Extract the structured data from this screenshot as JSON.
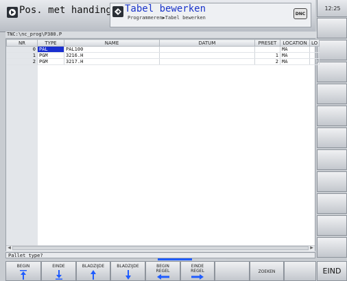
{
  "header": {
    "mode1_label": "Pos. met handingave",
    "mode2_label": "Tabel bewerken",
    "breadcrumb": "Programmeren▶Tabel bewerken",
    "dnc_label": "DNC",
    "clock": "12:25"
  },
  "file_path": "TNC:\\nc_prog\\P380.P",
  "table": {
    "columns": [
      "NR",
      "TYPE",
      "NAME",
      "DATUM",
      "PRESET",
      "LOCATION",
      "LO"
    ],
    "rows": [
      {
        "nr": "0",
        "type": "PAL",
        "name": "PAL100",
        "datum": "",
        "preset": "",
        "location": "MA"
      },
      {
        "nr": "1",
        "type": "PGM",
        "name": "3216.H",
        "datum": "",
        "preset": "1",
        "location": "MA"
      },
      {
        "nr": "2",
        "type": "PGM",
        "name": "3217.H",
        "datum": "",
        "preset": "2",
        "location": "MA"
      }
    ]
  },
  "status_line": "Pallet type?",
  "softkeys": {
    "begin": "BEGIN",
    "einde": "EINDE",
    "bladzijde_up": "BLADZIJDE",
    "bladzijde_down": "BLADZIJDE",
    "begin_regel_1": "BEGIN",
    "begin_regel_2": "REGEL",
    "einde_regel_1": "EINDE",
    "einde_regel_2": "REGEL",
    "zoeken": "ZOEKEN",
    "eind": "EIND"
  },
  "colors": {
    "selected_cell": "#1a2fd0",
    "mode2_text": "#1a34c9",
    "softkey_indicator": "#1f5cff"
  }
}
